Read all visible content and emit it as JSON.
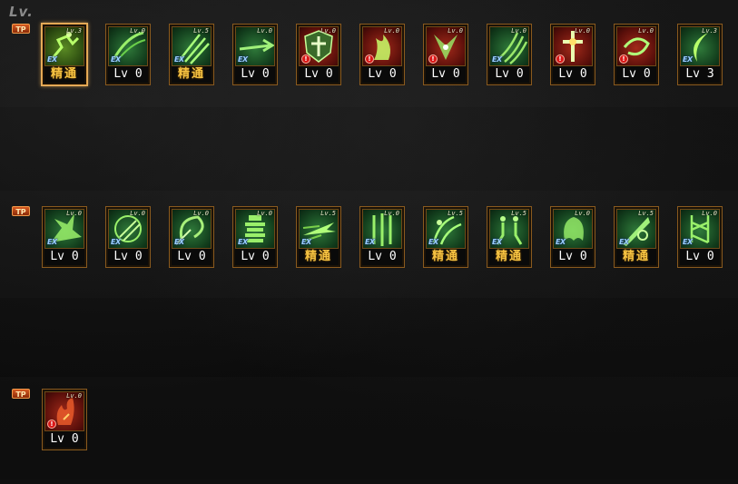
{
  "header": {
    "lv_label": "Lv."
  },
  "tp_badge_label": "TP",
  "rows": [
    {
      "skills": [
        {
          "mini_lv": "Lv.3",
          "tag": "ex",
          "level": "精通",
          "mastered": true,
          "frame": "gold",
          "icon": "leaping-figure-icon",
          "selected": true
        },
        {
          "mini_lv": "Lv.0",
          "tag": "ex",
          "level": "Lv 0",
          "mastered": false,
          "frame": "green",
          "icon": "slash-arcs-icon"
        },
        {
          "mini_lv": "Lv.5",
          "tag": "ex",
          "level": "精通",
          "mastered": true,
          "frame": "green",
          "icon": "claw-strike-icon"
        },
        {
          "mini_lv": "Lv.0",
          "tag": "ex",
          "level": "Lv 0",
          "mastered": false,
          "frame": "green",
          "icon": "sword-thrust-icon"
        },
        {
          "mini_lv": "Lv.0",
          "tag": "warn",
          "level": "Lv 0",
          "mastered": false,
          "frame": "red",
          "icon": "shield-cross-icon"
        },
        {
          "mini_lv": "Lv.0",
          "tag": "warn",
          "level": "Lv 0",
          "mastered": false,
          "frame": "red",
          "icon": "rising-flame-icon"
        },
        {
          "mini_lv": "Lv.0",
          "tag": "warn",
          "level": "Lv 0",
          "mastered": false,
          "frame": "red",
          "icon": "winged-burst-icon"
        },
        {
          "mini_lv": "Lv.0",
          "tag": "ex",
          "level": "Lv 0",
          "mastered": false,
          "frame": "green",
          "icon": "triple-claw-icon"
        },
        {
          "mini_lv": "Lv.0",
          "tag": "warn",
          "level": "Lv 0",
          "mastered": false,
          "frame": "red",
          "icon": "cross-blade-icon"
        },
        {
          "mini_lv": "Lv.0",
          "tag": "warn",
          "level": "Lv 0",
          "mastered": false,
          "frame": "red",
          "icon": "whirlwind-icon"
        },
        {
          "mini_lv": "Lv.3",
          "tag": "ex",
          "level": "Lv 3",
          "mastered": false,
          "frame": "green",
          "icon": "crescent-slash-icon"
        }
      ]
    },
    {
      "skills": [
        {
          "mini_lv": "Lv.0",
          "tag": "ex",
          "level": "Lv 0",
          "mastered": false,
          "frame": "green",
          "icon": "burst-strike-icon"
        },
        {
          "mini_lv": "Lv.0",
          "tag": "ex",
          "level": "Lv 0",
          "mastered": false,
          "frame": "green",
          "icon": "beast-claw-icon"
        },
        {
          "mini_lv": "Lv.0",
          "tag": "ex",
          "level": "Lv 0",
          "mastered": false,
          "frame": "green",
          "icon": "swirl-slash-icon"
        },
        {
          "mini_lv": "Lv.0",
          "tag": "ex",
          "level": "Lv 0",
          "mastered": false,
          "frame": "green",
          "icon": "armored-figure-icon"
        },
        {
          "mini_lv": "Lv.5",
          "tag": "ex",
          "level": "精通",
          "mastered": true,
          "frame": "green",
          "icon": "piercing-dash-icon"
        },
        {
          "mini_lv": "Lv.0",
          "tag": "ex",
          "level": "Lv 0",
          "mastered": false,
          "frame": "green",
          "icon": "blade-pillars-icon"
        },
        {
          "mini_lv": "Lv.5",
          "tag": "ex",
          "level": "精通",
          "mastered": true,
          "frame": "green",
          "icon": "shadow-strike-icon"
        },
        {
          "mini_lv": "Lv.5",
          "tag": "ex",
          "level": "精通",
          "mastered": true,
          "frame": "green",
          "icon": "twin-figures-icon"
        },
        {
          "mini_lv": "Lv.0",
          "tag": "ex",
          "level": "Lv 0",
          "mastered": false,
          "frame": "green",
          "icon": "ghost-wisp-icon"
        },
        {
          "mini_lv": "Lv.5",
          "tag": "ex",
          "level": "精通",
          "mastered": true,
          "frame": "green",
          "icon": "phantom-blade-icon"
        },
        {
          "mini_lv": "Lv.0",
          "tag": "ex",
          "level": "Lv 0",
          "mastered": false,
          "frame": "green",
          "icon": "spirit-totem-icon"
        }
      ]
    },
    {
      "skills": [
        {
          "mini_lv": "Lv.0",
          "tag": "warn",
          "level": "Lv 0",
          "mastered": false,
          "frame": "red",
          "icon": "flame-burst-icon"
        }
      ]
    }
  ],
  "tags": {
    "ex": "EX",
    "warn": "!"
  },
  "colors": {
    "frame": "#8a5a1e",
    "mastered_text": "#f5c242",
    "level_text": "#ffffff",
    "tp_badge": "#d65a20"
  }
}
